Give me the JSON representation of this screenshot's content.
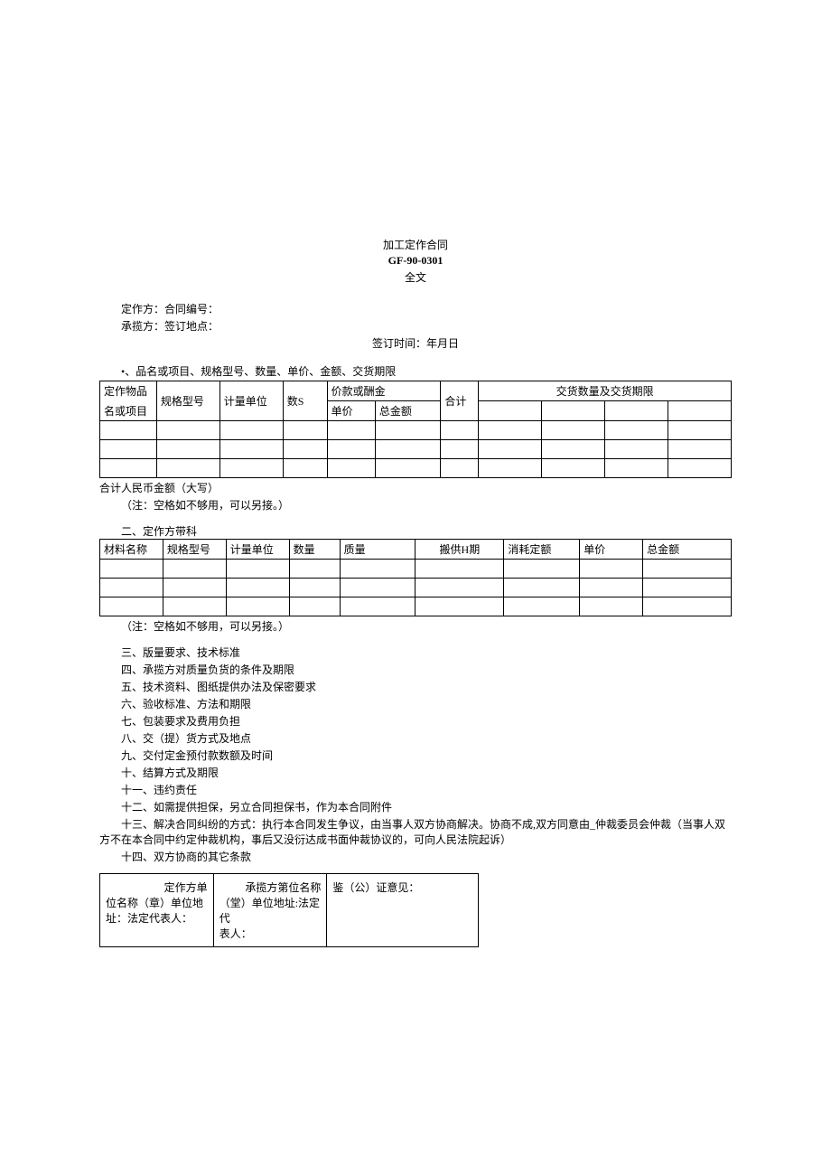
{
  "header": {
    "title": "加工定作合同",
    "code": "GF-90-0301",
    "subtitle": "全文"
  },
  "parties": {
    "line1": "定作方：合同编号：",
    "line2": "承揽方：签订地点：",
    "line3": "签订时间：年月日"
  },
  "section1": {
    "title": "•、品名或项目、规格型号、数量、单价、金额、交货期限",
    "cols": {
      "c1": "定作物品",
      "c1b": "名或项目",
      "c2": "规格型号",
      "c3": "计量单位",
      "c4": "数S",
      "c5": "价款或酬金",
      "c5a": "单价",
      "c5b": "总金额",
      "c6": "合计",
      "c7": "交货数量及交货期限"
    },
    "total": "合计人民币金额（大写）",
    "note": "（注：空格如不够用，可以另接。）"
  },
  "section2": {
    "title": "二、定作方带科",
    "cols": {
      "c1": "材料名称",
      "c2": "规格型号",
      "c3": "计量单位",
      "c4": "数量",
      "c5": "质量",
      "c6": "搬供H期",
      "c7": "消耗定额",
      "c8": "单价",
      "c9": "总金额"
    },
    "note": "（注：空格如不够用，可以另接。）"
  },
  "clauses": {
    "c3": "三、版量要求、技术标准",
    "c4": "四、承揽方对质量负货的条件及期限",
    "c5": "五、技术资料、图纸提供办法及保密要求",
    "c6": "六、验收标准、方法和期限",
    "c7": "七、包装要求及费用负担",
    "c8": "八、交（提）货方式及地点",
    "c9": "九、交付定金预付款数额及时间",
    "c10": "十、结算方式及期限",
    "c11": "十一、违约责任",
    "c12": "十二、如需提供担保，另立合同担保书，作为本合同附件",
    "c13": "十三、解决合同纠纷的方式：执行本合同发生争议，由当事人双方协商解决。协商不成,双方同意由_仲裁委员会仲裁（当事人双方不在本合同中约定仲裁机构，事后又没衍达成书面仲裁协议的，可向人民法院起诉）",
    "c14": "十四、双方协商的其它条款"
  },
  "signTable": {
    "col1": "定作方单位名称（章）单位地址：法定代表人：",
    "col1a": "定作方单",
    "col1b": "位名称（章）单位地",
    "col1c": "址：法定代表人：",
    "col2a": "承揽方第位名称",
    "col2b": "（堂）单位地址:法定代",
    "col2c": "表人：",
    "col3": "鉴（公）证意见："
  }
}
